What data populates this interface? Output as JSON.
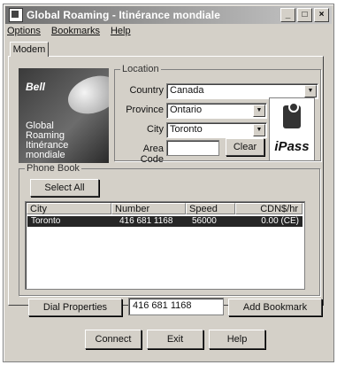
{
  "window": {
    "title": "Global Roaming - Itinérance mondiale"
  },
  "title_buttons": {
    "minimize": "_",
    "maximize": "□",
    "close": "×"
  },
  "menu": {
    "options": "Options",
    "bookmarks": "Bookmarks",
    "help": "Help"
  },
  "tabs": {
    "modem": "Modem"
  },
  "logo": {
    "brand": "Bell",
    "line1": "Global",
    "line2": "Roaming",
    "line3": "Itinérance",
    "line4": "mondiale"
  },
  "location": {
    "group_label": "Location",
    "country_label": "Country",
    "country_value": "Canada",
    "province_label": "Province",
    "province_value": "Ontario",
    "city_label": "City",
    "city_value": "Toronto",
    "area_code_label": "Area Code",
    "area_code_value": "",
    "clear_label": "Clear"
  },
  "ipass": {
    "text": "iPass"
  },
  "phonebook": {
    "group_label": "Phone Book",
    "select_all_label": "Select All",
    "columns": [
      "City",
      "Number",
      "Speed",
      "CDN$/hr"
    ],
    "rows": [
      {
        "city": "Toronto",
        "number": "416 681 1168",
        "speed": "56000",
        "rate": "0.00 (CE)"
      }
    ]
  },
  "dial": {
    "properties_label": "Dial Properties",
    "number_value": "416 681 1168",
    "add_bookmark_label": "Add Bookmark"
  },
  "footer": {
    "connect": "Connect",
    "exit": "Exit",
    "help": "Help"
  }
}
